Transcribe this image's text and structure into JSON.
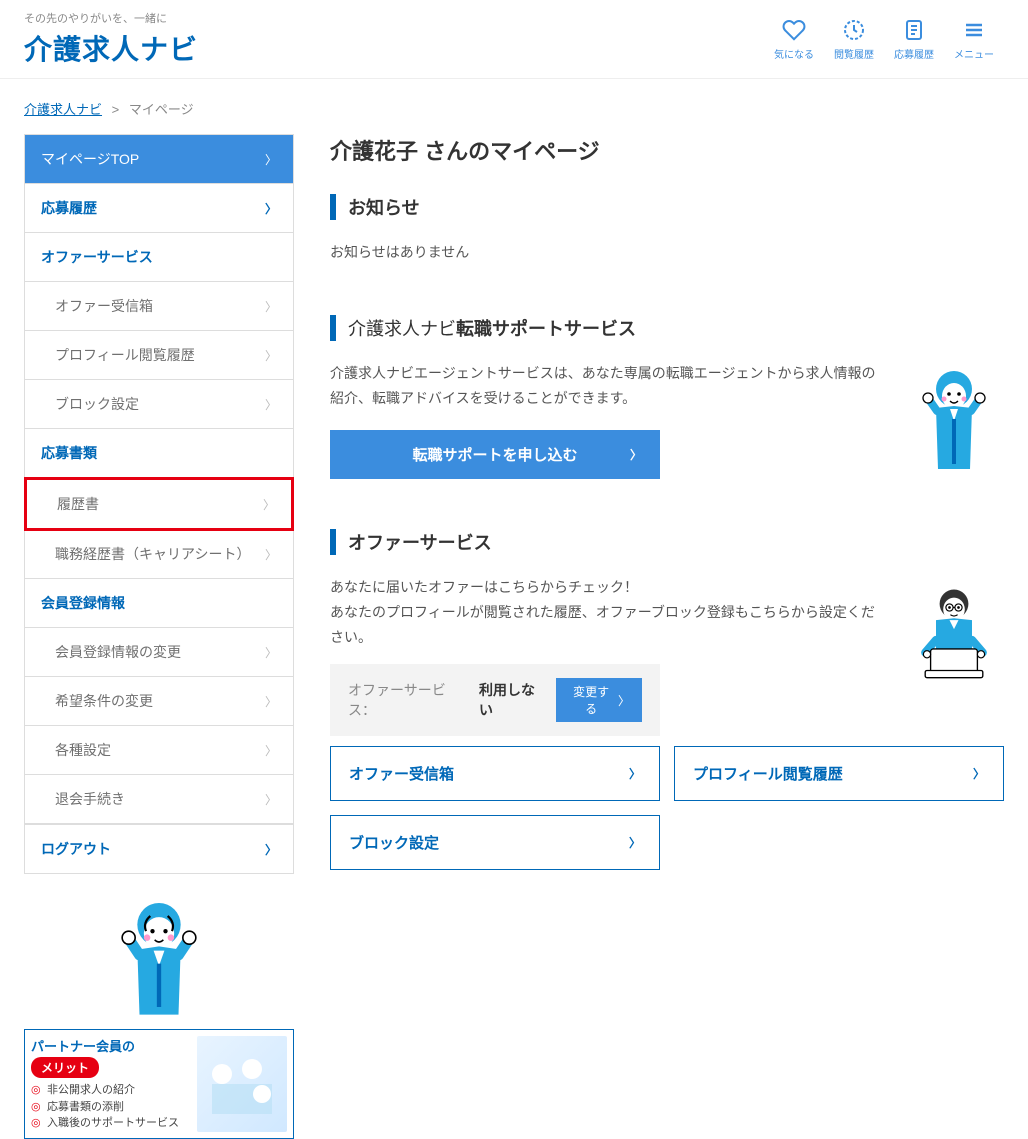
{
  "header": {
    "tagline": "その先のやりがいを、一緒に",
    "logo": "介護求人ナビ",
    "nav": [
      {
        "label": "気になる",
        "icon": "heart"
      },
      {
        "label": "閲覧履歴",
        "icon": "clock"
      },
      {
        "label": "応募履歴",
        "icon": "document"
      },
      {
        "label": "メニュー",
        "icon": "menu"
      }
    ]
  },
  "breadcrumb": {
    "home": "介護求人ナビ",
    "current": "マイページ"
  },
  "sidebar": {
    "top": "マイページTOP",
    "items": [
      {
        "label": "応募履歴",
        "type": "primary"
      },
      {
        "label": "オファーサービス",
        "type": "primary"
      },
      {
        "label": "オファー受信箱",
        "type": "sub"
      },
      {
        "label": "プロフィール閲覧履歴",
        "type": "sub"
      },
      {
        "label": "ブロック設定",
        "type": "sub"
      },
      {
        "label": "応募書類",
        "type": "primary"
      },
      {
        "label": "履歴書",
        "type": "sub",
        "highlighted": true
      },
      {
        "label": "職務経歴書（キャリアシート）",
        "type": "sub"
      },
      {
        "label": "会員登録情報",
        "type": "primary"
      },
      {
        "label": "会員登録情報の変更",
        "type": "sub"
      },
      {
        "label": "希望条件の変更",
        "type": "sub"
      },
      {
        "label": "各種設定",
        "type": "sub"
      },
      {
        "label": "退会手続き",
        "type": "sub"
      }
    ],
    "logout": "ログアウト",
    "partner": {
      "title": "パートナー会員の",
      "merit": "メリット",
      "list": [
        "非公開求人の紹介",
        "応募書類の添削",
        "入職後のサポートサービス"
      ]
    }
  },
  "main": {
    "page_title": "介護花子 さんのマイページ",
    "news": {
      "title": "お知らせ",
      "empty": "お知らせはありません"
    },
    "support": {
      "title_light": "介護求人ナビ",
      "title_bold": "転職サポートサービス",
      "desc": "介護求人ナビエージェントサービスは、あなた専属の転職エージェントから求人情報の紹介、転職アドバイスを受けることができます。",
      "cta": "転職サポートを申し込む"
    },
    "offer": {
      "title": "オファーサービス",
      "desc1": "あなたに届いたオファーはこちらからチェック！",
      "desc2": "あなたのプロフィールが閲覧された履歴、オファーブロック登録もこちらから設定ください。",
      "status_label": "オファーサービス：",
      "status_value": "利用しない",
      "change_btn": "変更する",
      "links": [
        "オファー受信箱",
        "プロフィール閲覧履歴",
        "ブロック設定"
      ]
    }
  }
}
